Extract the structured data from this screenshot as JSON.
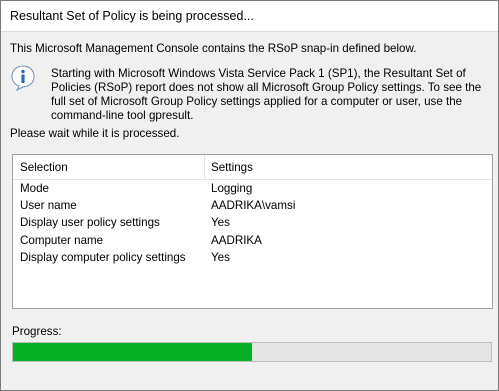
{
  "window": {
    "title": "Resultant Set of Policy is being processed..."
  },
  "body": {
    "intro": "This Microsoft Management Console contains the RSoP snap-in defined below.",
    "info_icon": "info-icon",
    "info_text": "Starting with Microsoft Windows Vista Service Pack 1 (SP1), the Resultant Set of Policies (RSoP) report does not show all Microsoft Group Policy settings.  To see the full set of Microsoft Group Policy settings applied for a computer or user, use the command-line tool gpresult.",
    "wait_text": "Please wait while it is processed."
  },
  "table": {
    "headers": [
      "Selection",
      "Settings"
    ],
    "rows": [
      [
        "Mode",
        "Logging"
      ],
      [
        "User name",
        "AADRIKA\\vamsi"
      ],
      [
        "Display user policy settings",
        "Yes"
      ],
      [
        "Computer name",
        "AADRIKA"
      ],
      [
        "Display computer policy settings",
        "Yes"
      ]
    ]
  },
  "progress": {
    "label": "Progress:",
    "fraction": 0.5,
    "color": "#06b025"
  }
}
